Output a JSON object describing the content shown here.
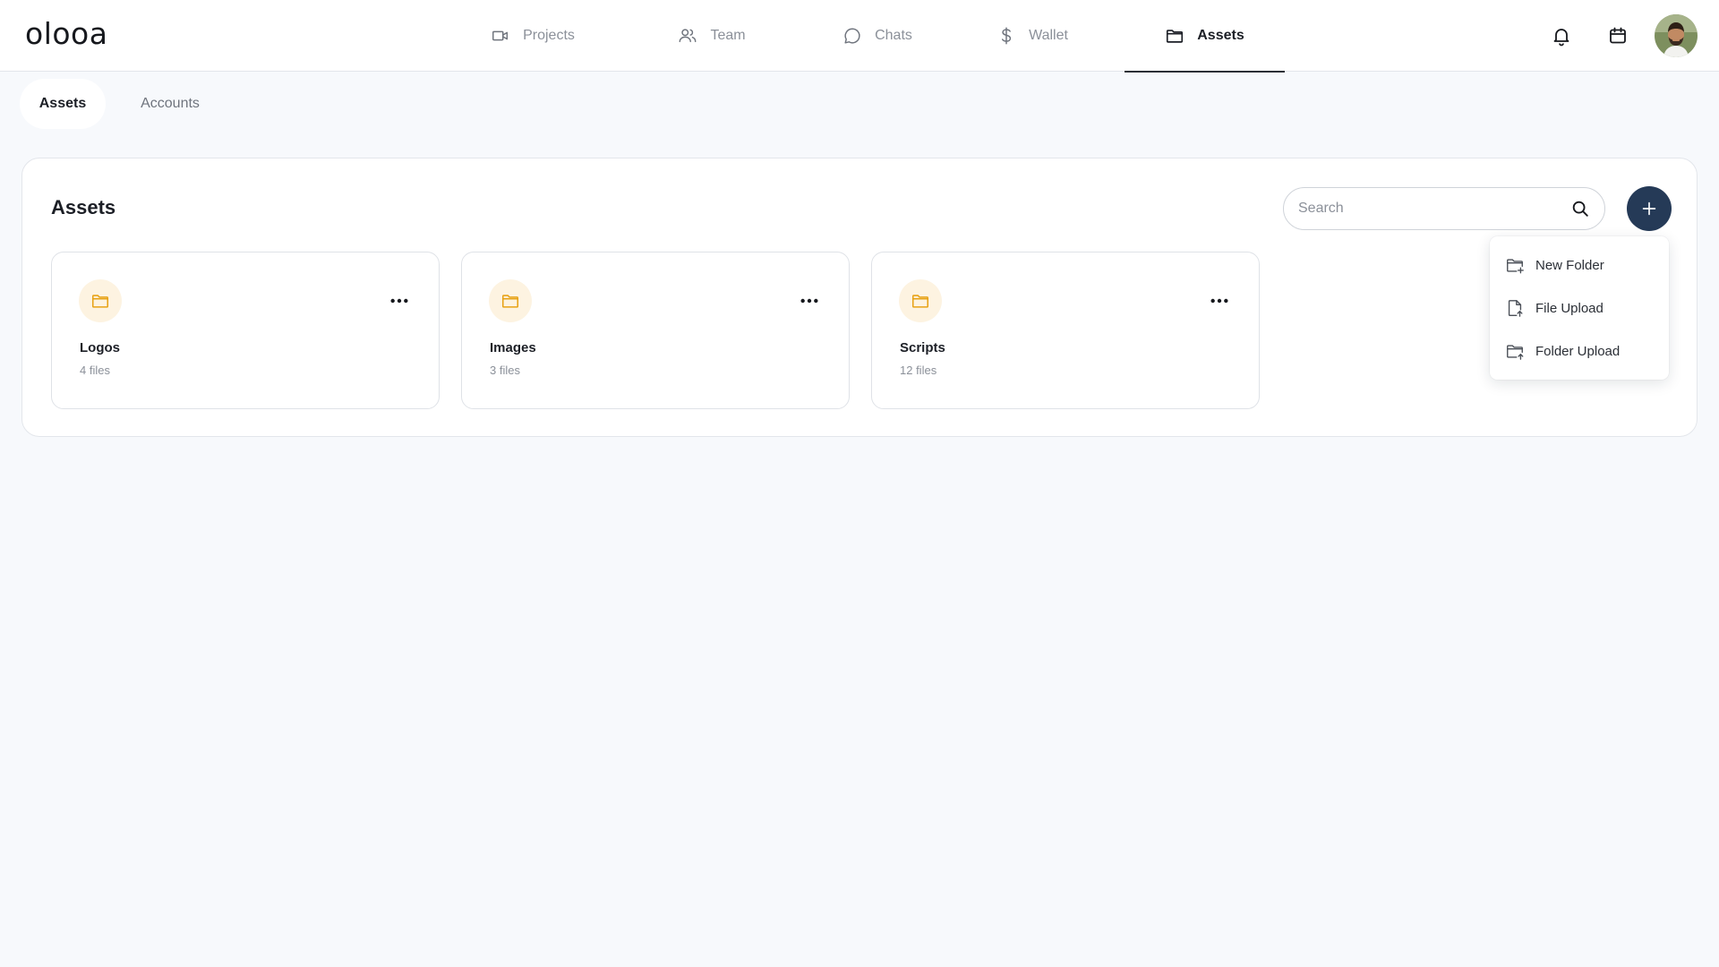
{
  "app": {
    "logo": "olooa"
  },
  "nav": {
    "items": [
      {
        "label": "Projects",
        "icon": "video-camera-icon",
        "active": false
      },
      {
        "label": "Team",
        "icon": "users-icon",
        "active": false
      },
      {
        "label": "Chats",
        "icon": "chat-bubble-icon",
        "active": false
      },
      {
        "label": "Wallet",
        "icon": "dollar-icon",
        "active": false
      },
      {
        "label": "Assets",
        "icon": "folder-icon",
        "active": true
      }
    ]
  },
  "header_actions": {
    "icons": [
      "bell-icon",
      "calendar-icon",
      "avatar"
    ]
  },
  "subtabs": [
    {
      "label": "Assets",
      "active": true
    },
    {
      "label": "Accounts",
      "active": false
    }
  ],
  "panel": {
    "title": "Assets",
    "search": {
      "placeholder": "Search",
      "value": ""
    },
    "add_button_icon": "plus-icon"
  },
  "folders": [
    {
      "name": "Logos",
      "count": "4 files"
    },
    {
      "name": "Images",
      "count": "3 files"
    },
    {
      "name": "Scripts",
      "count": "12 files"
    }
  ],
  "add_menu": {
    "items": [
      {
        "label": "New Folder",
        "icon": "folder-plus-icon"
      },
      {
        "label": "File Upload",
        "icon": "file-upload-icon"
      },
      {
        "label": "Folder Upload",
        "icon": "folder-upload-icon"
      }
    ]
  },
  "colors": {
    "accent": "#253a57",
    "folder_icon": "#e8a317",
    "folder_badge_bg": "#fdf3e1",
    "page_bg": "#f7f9fc"
  }
}
